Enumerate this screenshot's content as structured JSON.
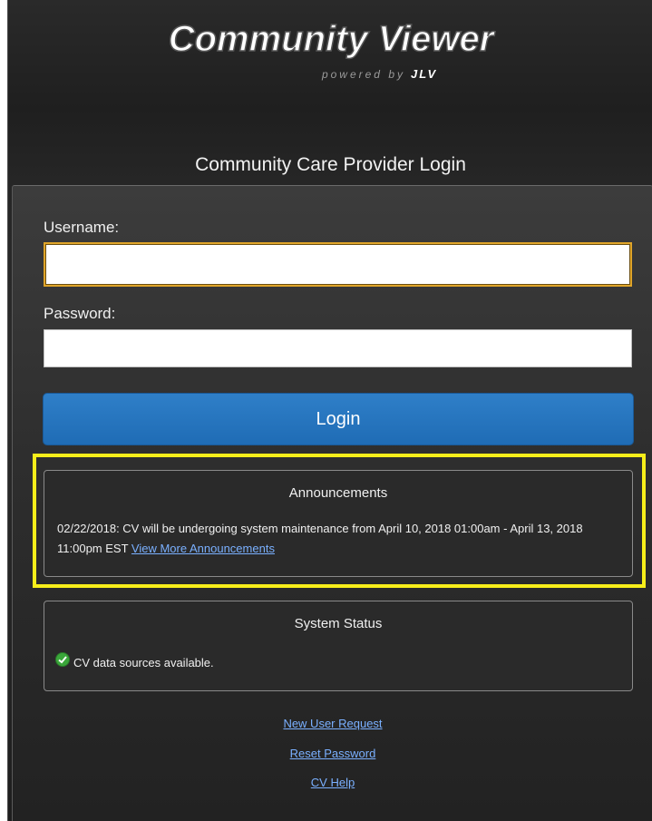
{
  "header": {
    "logo_text": "Community Viewer",
    "logo_subtext_prefix": "powered by",
    "logo_subtext_brand": "JLV",
    "title": "Community Care Provider Login"
  },
  "login_form": {
    "username_label": "Username:",
    "username_value": "",
    "password_label": "Password:",
    "password_value": "",
    "login_button_label": "Login"
  },
  "announcements": {
    "title": "Announcements",
    "text": "02/22/2018: CV will be undergoing system maintenance from April 10, 2018 01:00am - April 13, 2018 11:00pm EST",
    "link_label": "View More Announcements"
  },
  "system_status": {
    "title": "System Status",
    "icon": "check-circle-icon",
    "message": "CV data sources available."
  },
  "footer_links": {
    "new_user": "New User Request",
    "reset_password": "Reset Password",
    "help": "CV Help"
  },
  "colors": {
    "login_button": "#1f6cb5",
    "highlight_border": "#f7ee1a",
    "focus_border": "#e0a52a",
    "link": "#7ab0ff",
    "status_ok": "#3aa63a"
  }
}
